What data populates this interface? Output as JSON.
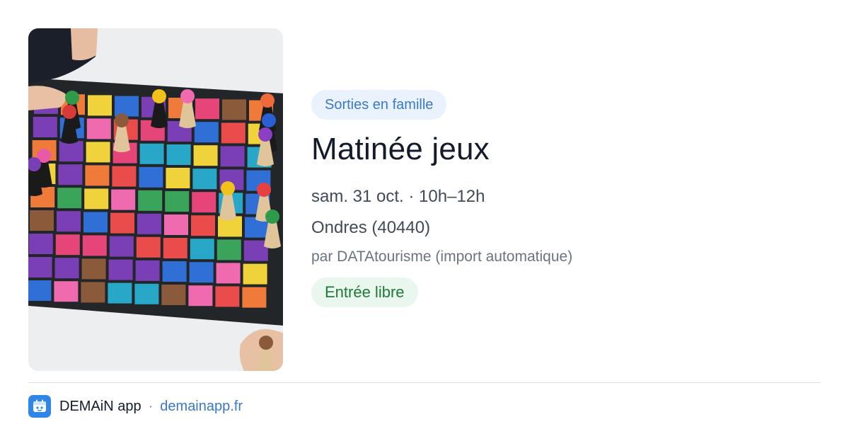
{
  "event": {
    "category": "Sorties en famille",
    "title": "Matinée jeux",
    "datetime": "sam. 31 oct. · 10h–12h",
    "location": "Ondres (40440)",
    "source": "par DATAtourisme (import automatique)",
    "price": "Entrée libre"
  },
  "footer": {
    "app_name": "DEMAiN app",
    "separator": "·",
    "domain": "demainapp.fr"
  },
  "colors": {
    "category_bg": "#eaf2fd",
    "category_text": "#3a78c9",
    "price_bg": "#eaf7ee",
    "price_text": "#1f7a3a",
    "link": "#3a78c9",
    "logo_bg": "#2f86e6"
  },
  "icons": {
    "app_logo": "demain-logo-icon"
  }
}
